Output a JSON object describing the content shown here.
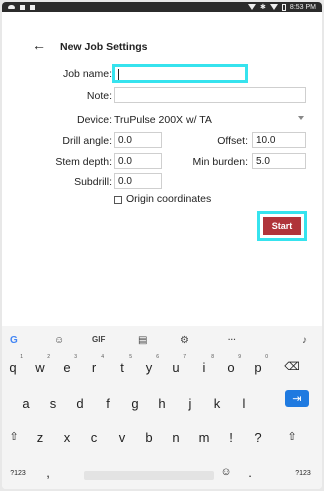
{
  "status_bar": {
    "time": "8:53 PM"
  },
  "app_bar": {
    "back_icon": "←",
    "title": "New Job Settings"
  },
  "form": {
    "job_name_label": "Job name:",
    "job_name_value": "",
    "note_label": "Note:",
    "note_value": "",
    "device_label": "Device:",
    "device_value": "TruPulse 200X w/ TA",
    "drill_angle_label": "Drill angle:",
    "drill_angle_value": "0.0",
    "offset_label": "Offset:",
    "offset_value": "10.0",
    "stem_depth_label": "Stem depth:",
    "stem_depth_value": "0.0",
    "min_burden_label": "Min burden:",
    "min_burden_value": "5.0",
    "subdrill_label": "Subdrill:",
    "subdrill_value": "0.0",
    "origin_label": "Origin coordinates",
    "origin_checked": false,
    "start_label": "Start"
  },
  "colors": {
    "highlight": "#36e3ee",
    "start_button": "#b0343a",
    "enter_key": "#1f7ae0"
  },
  "keyboard": {
    "toolbar": {
      "gif": "GIF",
      "more": "···"
    },
    "row1": [
      [
        "q",
        "1"
      ],
      [
        "w",
        "2"
      ],
      [
        "e",
        "3"
      ],
      [
        "r",
        "4"
      ],
      [
        "t",
        "5"
      ],
      [
        "y",
        "6"
      ],
      [
        "u",
        "7"
      ],
      [
        "i",
        "8"
      ],
      [
        "o",
        "9"
      ],
      [
        "p",
        "0"
      ]
    ],
    "row2": [
      "a",
      "s",
      "d",
      "f",
      "g",
      "h",
      "j",
      "k",
      "l"
    ],
    "row3": [
      "z",
      "x",
      "c",
      "v",
      "b",
      "n",
      "m",
      "!",
      "?"
    ],
    "bottom": {
      "symbols": "?123",
      "comma": ",",
      "period": ".",
      "symbols_right": "?123",
      "emoji": "☺"
    },
    "icons": {
      "enter": "⇥",
      "backspace": "⌫",
      "shift": "⇧"
    }
  }
}
